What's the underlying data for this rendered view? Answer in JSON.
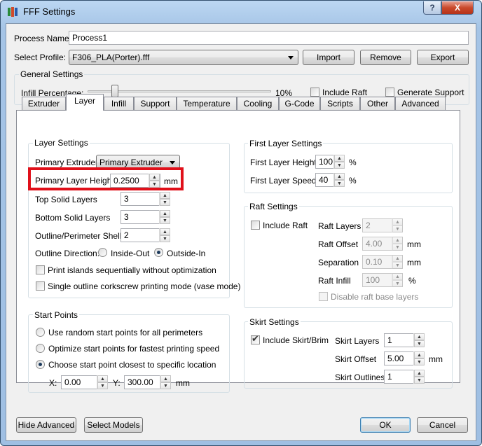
{
  "window": {
    "title": "FFF Settings",
    "help_label": "?",
    "close_label": "X"
  },
  "process_name": {
    "label": "Process Name:",
    "value": "Process1"
  },
  "select_profile": {
    "label": "Select Profile:",
    "value": "F306_PLA(Porter).fff"
  },
  "profile_buttons": {
    "import": "Import",
    "remove": "Remove",
    "export": "Export"
  },
  "general_settings": {
    "title": "General Settings",
    "infill_label": "Infill Percentage:",
    "infill_value_text": "10%",
    "infill_value": 10,
    "include_raft_label": "Include Raft",
    "include_raft_checked": false,
    "generate_support_label": "Generate Support",
    "generate_support_checked": false
  },
  "tabs": [
    "Extruder",
    "Layer",
    "Infill",
    "Support",
    "Temperature",
    "Cooling",
    "G-Code",
    "Scripts",
    "Other",
    "Advanced"
  ],
  "active_tab": "Layer",
  "layer_settings": {
    "title": "Layer Settings",
    "primary_extruder_label": "Primary Extruder",
    "primary_extruder_value": "Primary Extruder",
    "primary_layer_height_label": "Primary Layer Height",
    "primary_layer_height_value": "0.2500",
    "primary_layer_height_unit": "mm",
    "top_solid_layers_label": "Top Solid Layers",
    "top_solid_layers_value": "3",
    "bottom_solid_layers_label": "Bottom Solid Layers",
    "bottom_solid_layers_value": "3",
    "outline_shells_label": "Outline/Perimeter Shells",
    "outline_shells_value": "2",
    "outline_direction_label": "Outline Direction:",
    "inside_out_label": "Inside-Out",
    "outside_in_label": "Outside-In",
    "outline_direction_selected": "Outside-In",
    "print_islands_label": "Print islands sequentially without optimization",
    "single_outline_label": "Single outline corkscrew printing mode (vase mode)"
  },
  "start_points": {
    "title": "Start Points",
    "random_label": "Use random start points for all perimeters",
    "optimize_label": "Optimize start points for fastest printing speed",
    "choose_label": "Choose start point closest to specific location",
    "selected": "choose",
    "x_label": "X:",
    "x_value": "0.00",
    "y_label": "Y:",
    "y_value": "300.00",
    "unit": "mm"
  },
  "first_layer_settings": {
    "title": "First Layer Settings",
    "height_label": "First Layer Height",
    "height_value": "100",
    "height_unit": "%",
    "speed_label": "First Layer Speed",
    "speed_value": "40",
    "speed_unit": "%"
  },
  "raft_settings": {
    "title": "Raft Settings",
    "include_raft_label": "Include Raft",
    "include_raft_checked": false,
    "raft_layers_label": "Raft Layers",
    "raft_layers_value": "2",
    "raft_offset_label": "Raft Offset",
    "raft_offset_value": "4.00",
    "raft_offset_unit": "mm",
    "separation_label": "Separation",
    "separation_value": "0.10",
    "separation_unit": "mm",
    "raft_infill_label": "Raft Infill",
    "raft_infill_value": "100",
    "raft_infill_unit": "%",
    "disable_base_label": "Disable raft base layers"
  },
  "skirt_settings": {
    "title": "Skirt Settings",
    "include_label": "Include Skirt/Brim",
    "include_checked": true,
    "layers_label": "Skirt Layers",
    "layers_value": "1",
    "offset_label": "Skirt Offset",
    "offset_value": "5.00",
    "offset_unit": "mm",
    "outlines_label": "Skirt Outlines",
    "outlines_value": "1"
  },
  "bottom_buttons": {
    "hide_advanced": "Hide Advanced",
    "select_models": "Select Models",
    "ok": "OK",
    "cancel": "Cancel"
  },
  "colors": {
    "highlight": "#e0101a",
    "title_bar": "#a5c4e6",
    "close_button": "#c9492b"
  }
}
